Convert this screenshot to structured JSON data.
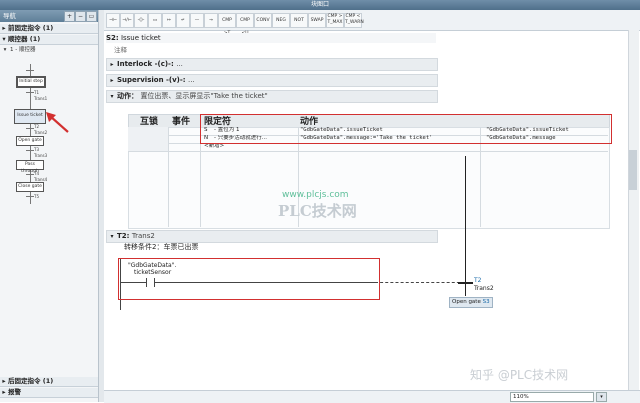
{
  "window": {
    "title": "块图口"
  },
  "navigator": {
    "title": "导航",
    "sections": [
      {
        "label": "前固定指令 (1)",
        "expanded": false
      },
      {
        "label": "顺控器 (1)",
        "expanded": true
      },
      {
        "label": "后固定指令 (1)",
        "expanded": false
      },
      {
        "label": "报警",
        "expanded": false
      }
    ],
    "sequence_label": "1 - 顺控器",
    "steps": [
      "Initial step",
      "Issue ticket",
      "Open gate",
      "Pass through",
      "Close gate"
    ],
    "transitions": [
      "T1",
      "Trans1",
      "T2",
      "Trans2",
      "T3",
      "Trans3",
      "T4",
      "Trans4",
      "T5"
    ]
  },
  "toolbar": {
    "buttons": [
      "CMP >T",
      "CMP <U",
      "CONV",
      "NEG",
      "NOT",
      "SWAP",
      "CMP > T_MAX",
      "CMP < T_WARN"
    ]
  },
  "step": {
    "header": "S2:",
    "name": "Issue ticket",
    "comment": "注释",
    "interlock": "Interlock -(c)-:",
    "interlock_val": "...",
    "supervision": "Supervision -(v)-:",
    "supervision_val": "...",
    "actions_label": "动作：",
    "actions_desc": "置位出票、显示屏显示\"Take the ticket\""
  },
  "actions_table": {
    "headers": [
      "互锁",
      "事件",
      "限定符",
      "动作"
    ],
    "rows": [
      {
        "qualifier": "S",
        "desc": "- 置位为 1",
        "action": "\"GdbGateData\".issueTicket",
        "target": "\"GdbGateData\".issueTicket"
      },
      {
        "qualifier": "N",
        "desc": "- 只要步活动就进行...",
        "action": "\"GdbGateData\".message:='Take the ticket'",
        "target": "\"GdbGateData\".message"
      }
    ],
    "new_row": "<新增>"
  },
  "transition": {
    "header": "T2:",
    "name": "Trans2",
    "desc": "转移条件2：车票已出票",
    "contact_db": "\"GdbGateData\".",
    "contact_tag": "ticketSensor",
    "label_t": "T2",
    "label_name": "Trans2",
    "next_step": "Open gate",
    "next_id": "S3"
  },
  "statusbar": {
    "zoom": "110%"
  },
  "watermarks": {
    "site": "www.plcjs.com",
    "brand": "PLC技术网",
    "zhihu": "知乎 @PLC技术网"
  },
  "colors": {
    "accent_red": "#d23030",
    "nav_header": "#6f8ea8"
  }
}
